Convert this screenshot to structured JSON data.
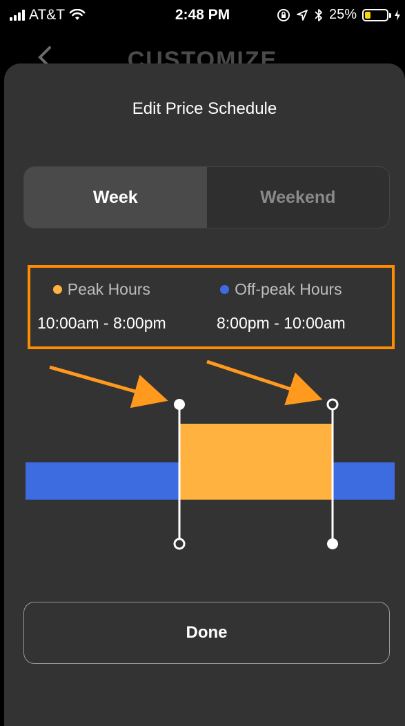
{
  "status_bar": {
    "carrier": "AT&T",
    "time": "2:48 PM",
    "battery_percent": "25%",
    "battery_level": 0.25,
    "icons": [
      "signal-icon",
      "wifi-icon",
      "orientation-lock-icon",
      "location-icon",
      "bluetooth-icon",
      "battery-icon",
      "charging-icon"
    ]
  },
  "nav": {
    "title": "CUSTOMIZE",
    "back_icon": "chevron-left-icon"
  },
  "sheet": {
    "title": "Edit Price Schedule",
    "tabs": [
      {
        "label": "Week",
        "active": true
      },
      {
        "label": "Weekend",
        "active": false
      }
    ],
    "legend": {
      "peak": {
        "label": "Peak Hours",
        "range": "10:00am - 8:00pm",
        "color": "#ffb23f"
      },
      "offpeak": {
        "label": "Off-peak Hours",
        "range": "8:00pm - 10:00am",
        "color": "#3d6be0"
      }
    },
    "done_label": "Done"
  },
  "colors": {
    "highlight": "#ff8c00",
    "sheet_bg": "#333333",
    "annotation_arrow": "#ff9a1f"
  }
}
